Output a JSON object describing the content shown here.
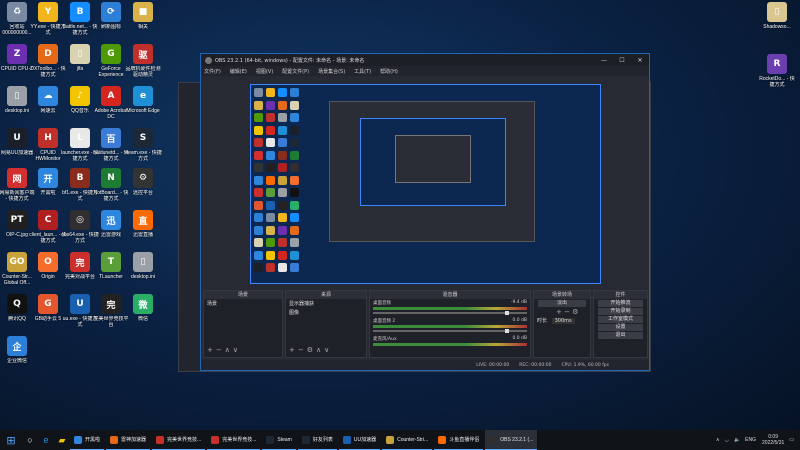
{
  "desktop": {
    "icons": [
      {
        "label": "回收站 000000000...",
        "color": "#7a8aa3",
        "glyph": "♻"
      },
      {
        "label": "YY.exe - 快捷方式",
        "color": "#f2b51c",
        "glyph": "Y"
      },
      {
        "label": "Battle.net... - 快捷方式",
        "color": "#148eff",
        "glyph": "B"
      },
      {
        "label": "刷新图标",
        "color": "#2d7fd6",
        "glyph": "⟳"
      },
      {
        "label": "相关",
        "color": "#d9b24a",
        "glyph": "■"
      },
      {
        "label": "CPUID CPU-Z",
        "color": "#6b2fb0",
        "glyph": "Z"
      },
      {
        "label": "DXToolbo... - 快捷方式",
        "color": "#e46a1a",
        "glyph": "D"
      },
      {
        "label": "jlfa",
        "color": "#d9d2b0",
        "glyph": "▯"
      },
      {
        "label": "GeForce Experience",
        "color": "#4e9a06",
        "glyph": "G"
      },
      {
        "label": "品牌机硬件检测 驱动精灵",
        "color": "#c0302a",
        "glyph": "驱"
      },
      {
        "label": "desktop.ini",
        "color": "#9aa0a6",
        "glyph": "▯"
      },
      {
        "label": "网速云",
        "color": "#2e86de",
        "glyph": "☁"
      },
      {
        "label": "QQ音乐",
        "color": "#f2c500",
        "glyph": "♪"
      },
      {
        "label": "Adobe Acrobat DC",
        "color": "#d4251e",
        "glyph": "A"
      },
      {
        "label": "Microsoft Edge",
        "color": "#1f8fd6",
        "glyph": "e"
      },
      {
        "label": "网易UU加速器",
        "color": "#1b1f2a",
        "glyph": "U"
      },
      {
        "label": "CPUID HWMonitor",
        "color": "#c0302a",
        "glyph": "H"
      },
      {
        "label": "launcher.exe - 快捷方式",
        "color": "#e8e8e8",
        "glyph": "L"
      },
      {
        "label": "baidunetd... - 快捷方式",
        "color": "#3a7bd5",
        "glyph": "百"
      },
      {
        "label": "steam.exe - 快捷方式",
        "color": "#1b2838",
        "glyph": "S"
      },
      {
        "label": "网易新闻客户端 - 快捷方式",
        "color": "#d32f2f",
        "glyph": "网"
      },
      {
        "label": "开黑啦",
        "color": "#2e86de",
        "glyph": "开"
      },
      {
        "label": "bf1.exe - 快捷方式",
        "color": "#8a2c1c",
        "glyph": "B"
      },
      {
        "label": "NotBoard... - 快捷方式",
        "color": "#1e7b34",
        "glyph": "N"
      },
      {
        "label": "远控平台",
        "color": "#333",
        "glyph": "⚙"
      },
      {
        "label": "OIP-C.jpg",
        "color": "#202020",
        "glyph": "PT"
      },
      {
        "label": "client_laun... - 快捷方式",
        "color": "#b12020",
        "glyph": "C"
      },
      {
        "label": "obs64.exe - 快捷方式",
        "color": "#302e31",
        "glyph": "◎"
      },
      {
        "label": "迅雷游戏",
        "color": "#2e86de",
        "glyph": "迅"
      },
      {
        "label": "迅雷直播",
        "color": "#ff6a00",
        "glyph": "直"
      },
      {
        "label": "Counter-Str... Global Off...",
        "color": "#caa23a",
        "glyph": "GO"
      },
      {
        "label": "Origin",
        "color": "#f56c2d",
        "glyph": "O"
      },
      {
        "label": "完美对战平台",
        "color": "#c9302c",
        "glyph": "完"
      },
      {
        "label": "TLauncher",
        "color": "#5a9e3a",
        "glyph": "T"
      },
      {
        "label": "desktop.ini",
        "color": "#9aa0a6",
        "glyph": "▯"
      },
      {
        "label": "腾讯QQ",
        "color": "#111",
        "glyph": "Q"
      },
      {
        "label": "GB助手云 5",
        "color": "#e4572e",
        "glyph": "G"
      },
      {
        "label": "uu.exe - 快捷方式",
        "color": "#1b5fb0",
        "glyph": "U"
      },
      {
        "label": "完美世界竞技平台",
        "color": "#222",
        "glyph": "完"
      },
      {
        "label": "微信",
        "color": "#2aae67",
        "glyph": "微"
      },
      {
        "label": "企业微信",
        "color": "#2b7fd6",
        "glyph": "企"
      }
    ],
    "right_icons": [
      {
        "label": "Shadowso...",
        "color": "#d9c690",
        "glyph": "▯"
      },
      {
        "label": "RocketDo... - 快捷方式",
        "color": "#6b3fb0",
        "glyph": "R"
      }
    ]
  },
  "obs": {
    "title": "OBS 23.2.1 (64-bit, windows) - 配置文件: 未命名 - 场景: 未命名",
    "menu": [
      "文件(F)",
      "编辑(E)",
      "视图(V)",
      "配置文件(P)",
      "场景集合(S)",
      "工具(T)",
      "帮助(H)"
    ],
    "docks": {
      "scenes": {
        "title": "场景",
        "items": [
          "场景"
        ]
      },
      "sources": {
        "title": "来源",
        "items": [
          "显示器捕获",
          "图像"
        ]
      },
      "mixer": {
        "title": "混音器",
        "channels": [
          {
            "name": "桌面音频",
            "db": "-9.4 dB"
          },
          {
            "name": "桌面音频 2",
            "db": "0.0 dB"
          },
          {
            "name": "麦克风/Aux",
            "db": "0.0 dB"
          }
        ]
      },
      "transitions": {
        "title": "场景转场",
        "type": "淡出",
        "duration_label": "时长",
        "duration": "300ms"
      },
      "controls": {
        "title": "控件",
        "buttons": [
          "开始推流",
          "开始录制",
          "工作室模式",
          "设置",
          "退出"
        ]
      }
    },
    "status": {
      "live": "LIVE: 00:00:00",
      "rec": "REC: 00:00:00",
      "cpu": "CPU: 1.9%, 60.00 fps"
    }
  },
  "taskbar": {
    "items": [
      {
        "label": "开黑啦",
        "color": "#2e86de"
      },
      {
        "label": "雷神加速器",
        "color": "#e46a1a"
      },
      {
        "label": "完美世界竞技...",
        "color": "#c9302c"
      },
      {
        "label": "完美世界竞技...",
        "color": "#c9302c"
      },
      {
        "label": "Steam",
        "color": "#1b2838"
      },
      {
        "label": "好友列表",
        "color": "#1b2838"
      },
      {
        "label": "UU加速器",
        "color": "#1b5fb0"
      },
      {
        "label": "Counter-Stri...",
        "color": "#caa23a"
      },
      {
        "label": "斗鱼直播伴侣",
        "color": "#ff6a00"
      },
      {
        "label": "OBS 23.2.1 (...",
        "color": "#302e31"
      }
    ],
    "lang": "ENG",
    "time": "0:09",
    "date": "2022/5/31"
  }
}
